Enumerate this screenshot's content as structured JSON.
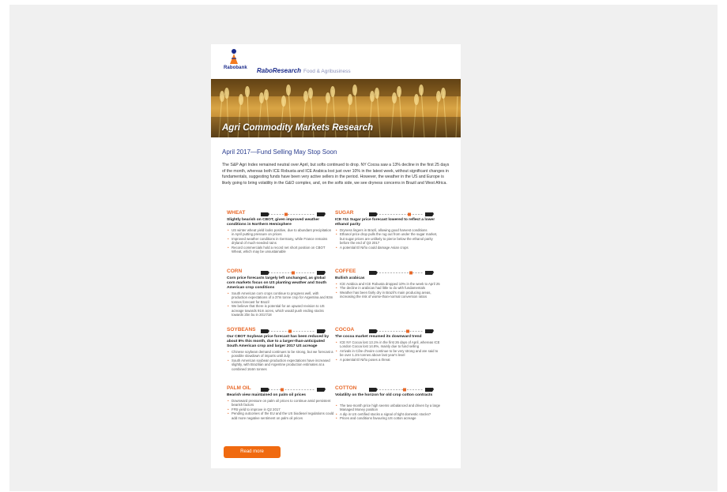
{
  "header": {
    "logo_text": "Rabobank",
    "brand": "RaboResearch",
    "brand_sub": "Food & Agribusiness"
  },
  "banner": {
    "title": "Agri Commodity Markets Research"
  },
  "subtitle": "April 2017—Fund Selling May Stop Soon",
  "intro": "The S&P Agri Index remained neutral over April, but softs continued to drop. NY Cocoa saw a 13% decline in the first 25 days of the month, whereas both ICE Robusta and ICE Arabica lost just over 10% in the latest week, without significant changes in fundamentals, suggesting funds have been very active sellers in the period. However, the weather in the US and Europe is likely going to bring volatility in the G&O complex, and, on the softs side, we see dryness concerns in Brazil and West Africa.",
  "sections": {
    "wheat": {
      "label": "WHEAT",
      "headline": "Slightly bearish on CBOT, given improved weather conditions in Northern Hemisphere",
      "bullets": [
        "US winter wheat yield looks positive, due to abundant precipitation in April putting pressure on prices",
        "Improved weather conditions in Germany, while France remains dryland of much-needed rains",
        "Record commercials hold a record net short position on CBOT Wheat, which may be unsustainable"
      ]
    },
    "corn": {
      "label": "CORN",
      "headline": "Corn price forecasts largely left unchanged, as global corn markets focus on US planting weather and South American crop conditions",
      "bullets": [
        "South American corn crops continue to progress well, with production expectations of a 37m tonne crop for Argentina and 93m tonnes forecast for Brazil",
        "We believe that there is potential for an upward revision to US acreage towards 91m acres, which would push ending stocks towards 2bn bu in 2017/18"
      ]
    },
    "soybeans": {
      "label": "SOYBEANS",
      "headline": "Our CBOT Soybean price forecast has been reduced by about 8% this month, due to a larger-than-anticipated South American crop and larger 2017 US acreage",
      "bullets": [
        "Chinese soybean demand continues to be strong, but we forecast a possible slowdown of imports until July",
        "South American soybean production expectations have increased slightly, with Brazilian and Argentine production estimates at a combined 164m tonnes"
      ]
    },
    "palm_oil": {
      "label": "PALM OIL",
      "headline": "Bearish view maintained on palm oil prices",
      "bullets": [
        "Downward pressure on palm oil prices to continue amid persistent bearish factors",
        "FFB yield to improve in Q2 2017",
        "Pending outcomes of the EU and the US biodiesel regulations could add more negative sentiment on palm oil prices"
      ]
    },
    "sugar": {
      "label": "SUGAR",
      "headline": "ICE #11 Sugar price forecast lowered to reflect a lower ethanol parity",
      "bullets": [
        "Dryness lingers in Brazil, allowing good harvest conditions",
        "Ethanol price drop pulls the rug out from under the sugar market, but sugar prices are unlikely to pierce below the ethanol parity before the end of Q3 2017",
        "A potential El Niño could damage Asian crops"
      ]
    },
    "coffee": {
      "label": "COFFEE",
      "headline": "Bullish arabicas",
      "bullets": [
        "ICE Arabica and ICE Robusta dropped 10% in the week to April 25",
        "The decline in arabicas had little to do with fundamentals",
        "Weather has been fairly dry in Brazil's main producing areas, increasing the risk of worse-than-normal conversion ratios"
      ]
    },
    "cocoa": {
      "label": "COCOA",
      "headline": "The cocoa market resumed its downward trend",
      "bullets": [
        "ICE NY Cocoa lost 13.1% in the first 26 days of April, whereas ICE London Cocoa lost 14.8%, mainly due to fund selling",
        "Arrivals in Côte d'Ivoire continue to be very strong and are said to be over 1.2m tonnes above last year's level",
        "A potential El Niño poses a threat"
      ]
    },
    "cotton": {
      "label": "COTTON",
      "headline": "Volatility on the horizon for old crop cotton contracts",
      "bullets": [
        "The two-month price high seems unbalanced and driven by a large Managed Money position",
        "A dip in US certified stocks a signal of tight domestic stocks?",
        "Prices and conditions favouring US cotton acreage"
      ]
    }
  },
  "read_more": "Read more",
  "colors": {
    "accent": "#e8692a",
    "brand_blue": "#1a2a8a",
    "button": "#f06a10"
  }
}
